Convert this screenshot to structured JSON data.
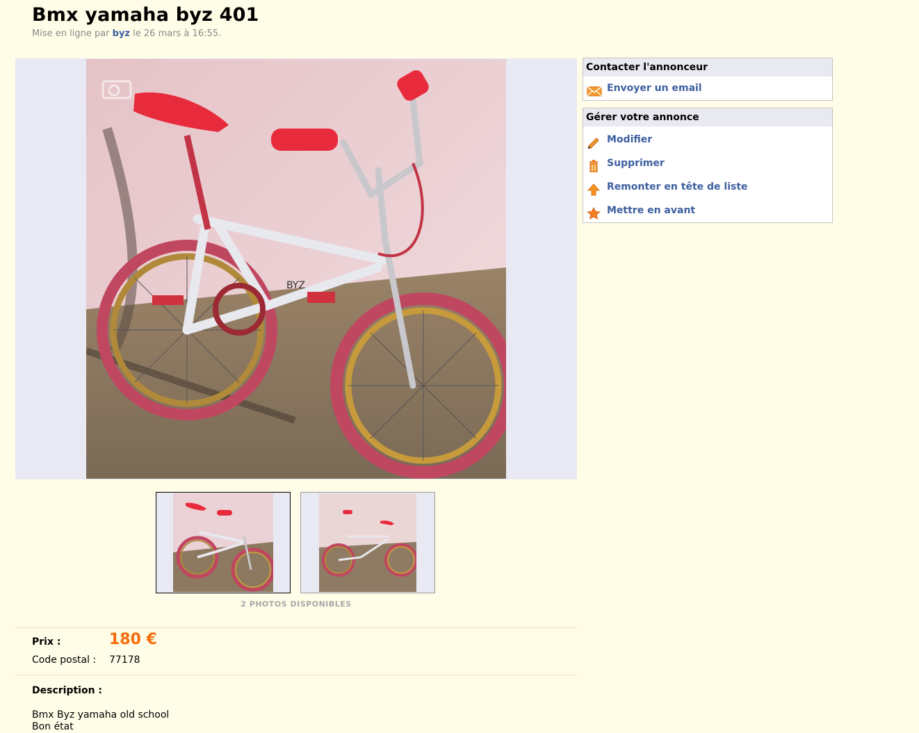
{
  "ad": {
    "title": "Bmx yamaha byz 401",
    "posted_prefix": "Mise en ligne par",
    "author": "byz",
    "posted_suffix": "le 26 mars à 16:55."
  },
  "gallery": {
    "caption": "2 PHOTOS DISPONIBLES"
  },
  "details": {
    "price_label": "Prix :",
    "price_value": "180 €",
    "postal_label": "Code postal :",
    "postal_value": "77178",
    "description_label": "Description :",
    "description_lines": [
      "Bmx Byz yamaha old school",
      "Bon état"
    ]
  },
  "contact_box": {
    "header": "Contacter l'annonceur",
    "items": [
      {
        "label": "Envoyer un email",
        "icon": "envelope-icon"
      }
    ]
  },
  "manage_box": {
    "header": "Gérer votre annonce",
    "items": [
      {
        "label": "Modifier",
        "icon": "pencil-icon"
      },
      {
        "label": "Supprimer",
        "icon": "trash-icon"
      },
      {
        "label": "Remonter en tête de liste",
        "icon": "arrow-up-icon"
      },
      {
        "label": "Mettre en avant",
        "icon": "star-icon"
      }
    ]
  },
  "colors": {
    "background": "#fffde7",
    "link": "#3d5fa0",
    "price": "#f56b0a",
    "photo_frame": "#e8e9f3"
  }
}
